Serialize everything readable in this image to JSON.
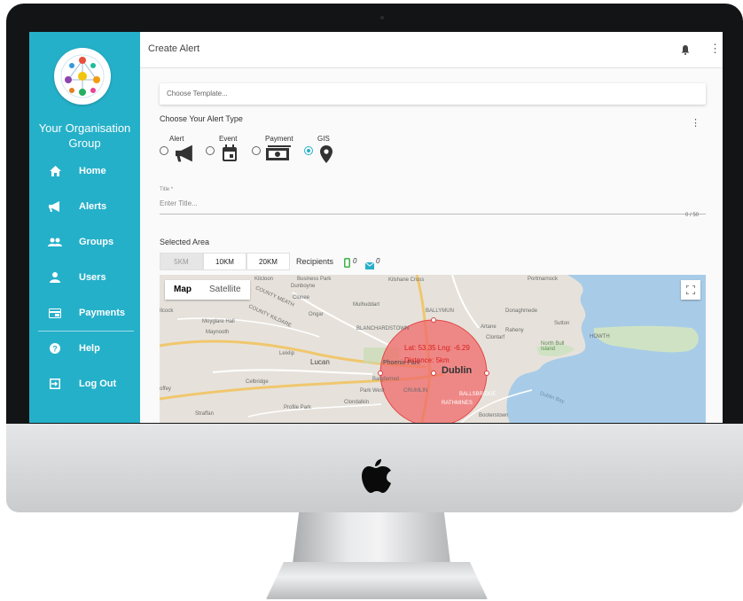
{
  "header": {
    "title": "Create Alert"
  },
  "sidebar": {
    "org_name": "Your Organisation Group",
    "items": [
      {
        "label": "Home",
        "icon": "home-icon"
      },
      {
        "label": "Alerts",
        "icon": "megaphone-icon"
      },
      {
        "label": "Groups",
        "icon": "groups-icon"
      },
      {
        "label": "Users",
        "icon": "user-icon"
      },
      {
        "label": "Payments",
        "icon": "payment-icon"
      },
      {
        "label": "Help",
        "icon": "help-icon"
      },
      {
        "label": "Log Out",
        "icon": "logout-icon"
      }
    ]
  },
  "template": {
    "placeholder": "Choose Template..."
  },
  "alert_type": {
    "heading": "Choose Your Alert Type",
    "options": [
      {
        "label": "Alert",
        "selected": false
      },
      {
        "label": "Event",
        "selected": false
      },
      {
        "label": "Payment",
        "selected": false
      },
      {
        "label": "GIS",
        "selected": true
      }
    ]
  },
  "title_field": {
    "label": "Title *",
    "placeholder": "Enter Title...",
    "counter": "0 / 50"
  },
  "area": {
    "heading": "Selected Area",
    "radius_options": [
      "5KM",
      "10KM",
      "20KM"
    ],
    "selected_radius": "5KM",
    "recipients_label": "Recipients",
    "phone_count": "0",
    "email_count": "0"
  },
  "map": {
    "map_label": "Map",
    "satellite_label": "Satellite",
    "circle_lat_lng": "Lat: 53.35 Lng: -6.29",
    "circle_distance": "Distance: 5km",
    "city_label": "Dublin",
    "places": [
      "Kilcloon",
      "Business Park",
      "Kilshane Cross",
      "Portmarnock",
      "Dunboyne",
      "Clonee",
      "Mulhuddart",
      "BALLYMUN",
      "Donaghmede",
      "Ilcock",
      "Ongar",
      "Moyglare Hall",
      "COUNTY MEATH",
      "COUNTY KILDARE",
      "Maynooth",
      "BLANCHARDSTOWN",
      "Artane",
      "Raheny",
      "Sutton",
      "Clontarf",
      "HOWTH",
      "North Bull Island",
      "Leixlip",
      "Lucan",
      "Phoenix Park",
      "Celbridge",
      "Ballyfermot",
      "offey",
      "Park West",
      "CRUMLIN",
      "Profile Park",
      "Clondalkin",
      "Straffan",
      "RATHMINES",
      "BALLSBRIDGE",
      "Booterstown",
      "Dublin Bay"
    ]
  },
  "colors": {
    "sidebar": "#25b0c9",
    "accent": "#25b0c9",
    "circle_fill": "#f06a6a",
    "water": "#a8cce8",
    "land": "#e6e2db"
  }
}
